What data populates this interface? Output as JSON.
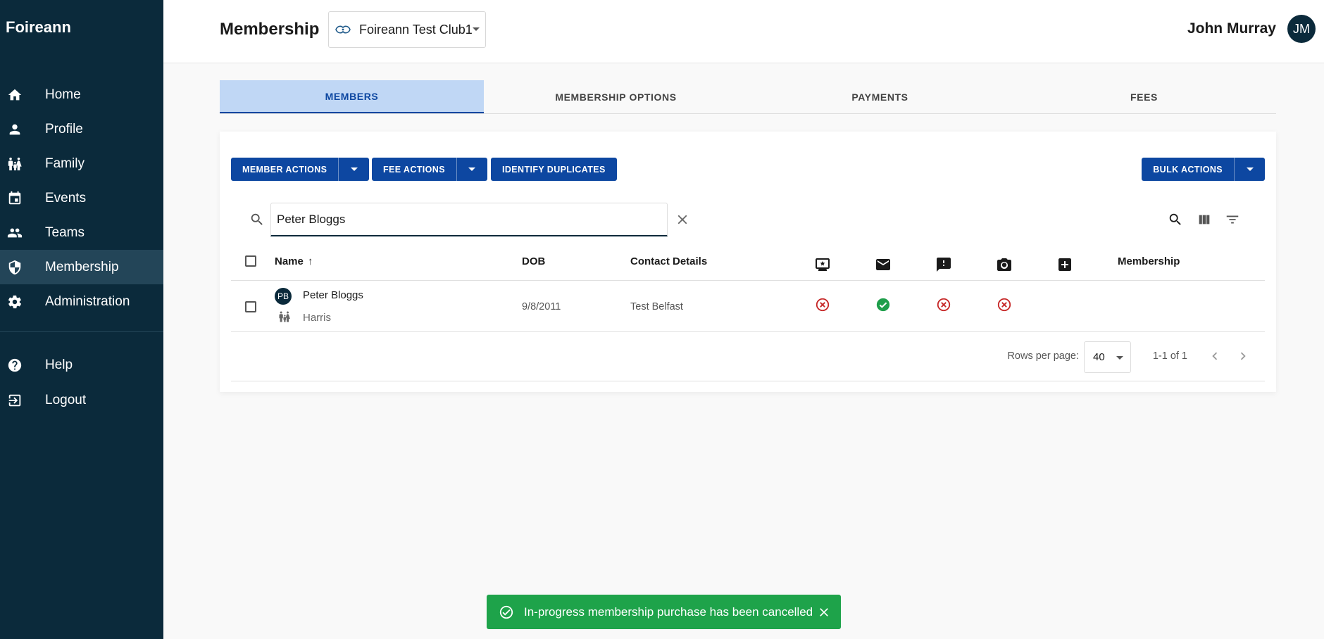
{
  "brand": "Foireann",
  "nav": {
    "items": [
      {
        "label": "Home",
        "icon": "home-icon"
      },
      {
        "label": "Profile",
        "icon": "person-icon"
      },
      {
        "label": "Family",
        "icon": "family-icon"
      },
      {
        "label": "Events",
        "icon": "calendar-icon"
      },
      {
        "label": "Teams",
        "icon": "group-icon"
      },
      {
        "label": "Membership",
        "icon": "shield-icon",
        "active": true
      },
      {
        "label": "Administration",
        "icon": "gear-icon"
      }
    ],
    "bottom": [
      {
        "label": "Help",
        "icon": "help-icon"
      },
      {
        "label": "Logout",
        "icon": "logout-icon"
      }
    ]
  },
  "header": {
    "title": "Membership",
    "club": "Foireann Test Club1",
    "user_name": "John Murray",
    "user_initials": "JM"
  },
  "tabs": [
    {
      "label": "MEMBERS",
      "active": true
    },
    {
      "label": "MEMBERSHIP OPTIONS"
    },
    {
      "label": "PAYMENTS"
    },
    {
      "label": "FEES"
    }
  ],
  "toolbar": {
    "member_actions": "MEMBER ACTIONS",
    "fee_actions": "FEE ACTIONS",
    "identify_duplicates": "IDENTIFY DUPLICATES",
    "bulk_actions": "BULK ACTIONS"
  },
  "search": {
    "value": "Peter Bloggs",
    "placeholder": ""
  },
  "table": {
    "columns": {
      "name": "Name",
      "sort_arrow": "↑",
      "dob": "DOB",
      "contact": "Contact Details",
      "membership": "Membership"
    },
    "icon_columns": [
      "online-icon",
      "email-icon",
      "alert-icon",
      "camera-icon",
      "medical-icon"
    ],
    "rows": [
      {
        "initials": "PB",
        "name": "Peter Bloggs",
        "family": "Harris",
        "dob": "9/8/2011",
        "contact": "Test Belfast",
        "statuses": [
          "no",
          "yes",
          "no",
          "no"
        ]
      }
    ]
  },
  "pagination": {
    "rows_per_page_label": "Rows per page:",
    "rows_per_page": "40",
    "range": "1-1 of 1"
  },
  "snackbar": {
    "message": "In-progress membership purchase has been cancelled"
  },
  "colors": {
    "sidebar": "#0b2a3b",
    "primary": "#0d47a1",
    "success": "#1ea34a",
    "error": "#c62828",
    "ok": "#1e9e4a"
  }
}
